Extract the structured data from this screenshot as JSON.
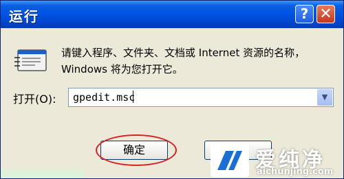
{
  "window": {
    "title": "运行",
    "help_glyph": "?",
    "close_glyph": "✕",
    "description": "请键入程序、文件夹、文档或 Internet 资源的名称，Windows 将为您打开它。",
    "open_label": "打开(O):",
    "command_value": "gpedit.msc",
    "combo_arrow": "▼",
    "ok_label": "确定",
    "cancel_label": "取"
  },
  "watermark": {
    "text": "爱纯净",
    "url": "aichunjing.com"
  },
  "colors": {
    "titlebar": "#0055E5",
    "highlight_ring": "#D72020",
    "window_bg": "#ECE9D8"
  }
}
